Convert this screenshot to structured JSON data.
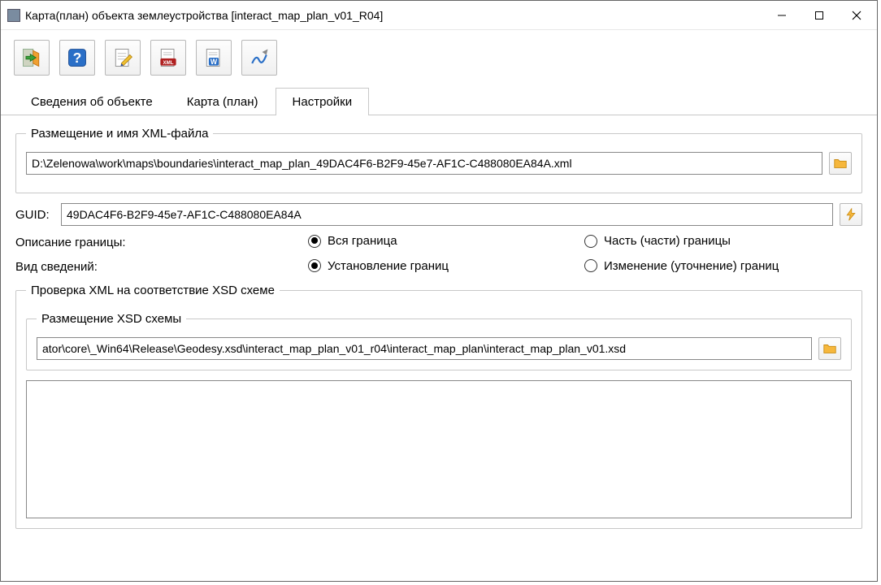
{
  "window": {
    "title": "Карта(план) объекта землеустройства [interact_map_plan_v01_R04]"
  },
  "toolbar": {
    "items": [
      "exit-icon",
      "help-icon",
      "edit-document-icon",
      "xml-document-icon",
      "word-document-icon",
      "sign-icon"
    ]
  },
  "tabs": [
    {
      "label": "Сведения об объекте",
      "active": false
    },
    {
      "label": "Карта (план)",
      "active": false
    },
    {
      "label": "Настройки",
      "active": true
    }
  ],
  "settings": {
    "xml_group_title": "Размещение и имя XML-файла",
    "xml_path": "D:\\Zelenowa\\work\\maps\\boundaries\\interact_map_plan_49DAC4F6-B2F9-45e7-AF1C-C488080EA84A.xml",
    "guid_label": "GUID:",
    "guid_value": "49DAC4F6-B2F9-45e7-AF1C-C488080EA84A",
    "boundary_desc_label": "Описание границы:",
    "boundary_desc_options": [
      {
        "label": "Вся граница",
        "checked": true
      },
      {
        "label": "Часть (части) границы",
        "checked": false
      }
    ],
    "info_type_label": "Вид сведений:",
    "info_type_options": [
      {
        "label": "Установление границ",
        "checked": true
      },
      {
        "label": "Изменение (уточнение) границ",
        "checked": false
      }
    ],
    "xsd_check_group_title": "Проверка XML на соответствие XSD схеме",
    "xsd_path_group_title": "Размещение XSD схемы",
    "xsd_path": "ator\\core\\_Win64\\Release\\Geodesy.xsd\\interact_map_plan_v01_r04\\interact_map_plan\\interact_map_plan_v01.xsd"
  }
}
